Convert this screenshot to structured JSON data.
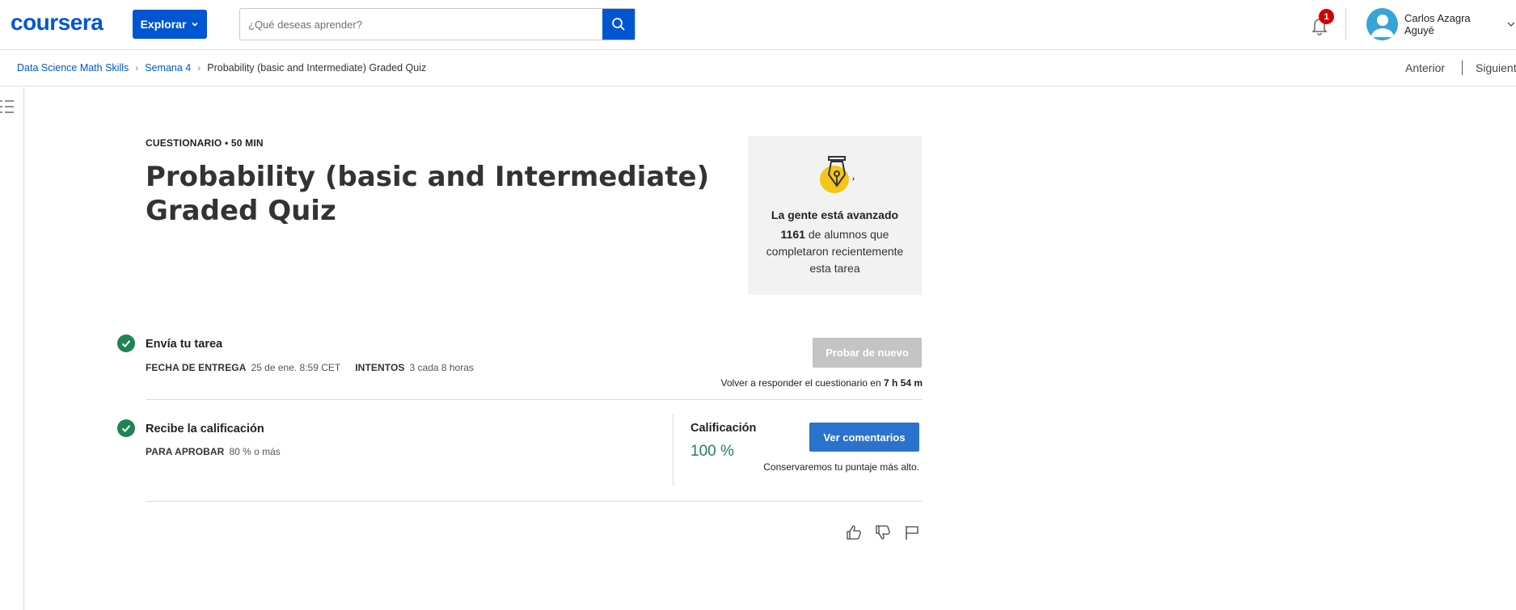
{
  "header": {
    "logo": "coursera",
    "explore_label": "Explorar",
    "search": {
      "placeholder": "¿Qué deseas aprender?",
      "value": ""
    },
    "notifications_count": "1",
    "user_name": "Carlos Azagra Aguyé"
  },
  "breadcrumb": {
    "items": [
      "Data Science Math Skills",
      "Semana 4"
    ],
    "current": "Probability (basic and Intermediate) Graded Quiz"
  },
  "nav": {
    "prev": "Anterior",
    "next": "Siguient"
  },
  "quiz": {
    "meta": "CUESTIONARIO • 50 MIN",
    "title": "Probability (basic and Intermediate) Graded Quiz"
  },
  "progress_card": {
    "heading": "La gente está avanzado",
    "count": "1161",
    "text": "de alumnos que completaron recientemente esta tarea"
  },
  "submit_row": {
    "title": "Envía tu tarea",
    "due_label": "FECHA DE ENTREGA",
    "due_value": "25 de ene. 8:59 CET",
    "attempts_label": "INTENTOS",
    "attempts_value": "3 cada 8 horas",
    "retry_label": "Probar de nuevo",
    "retry_note": "Volver a responder el cuestionario en",
    "retry_time": "7 h 54 m"
  },
  "grade_row": {
    "title": "Recibe la calificación",
    "pass_label": "PARA APROBAR",
    "pass_value": "80 % o más",
    "grade_label": "Calificación",
    "grade_value": "100 %",
    "feedback_label": "Ver comentarios",
    "keep_note": "Conservaremos tu puntaje más alto."
  },
  "colors": {
    "brand": "#0056d2",
    "success": "#1f8354",
    "button_primary": "#2a73cc",
    "button_disabled": "#c4c4c4",
    "badge": "#d30001"
  },
  "icons": [
    "chevron-down-icon",
    "search-icon",
    "bell-icon",
    "user-avatar-icon",
    "menu-list-icon",
    "pen-nib-icon",
    "check-icon",
    "thumbs-up-icon",
    "thumbs-down-icon",
    "flag-icon"
  ]
}
